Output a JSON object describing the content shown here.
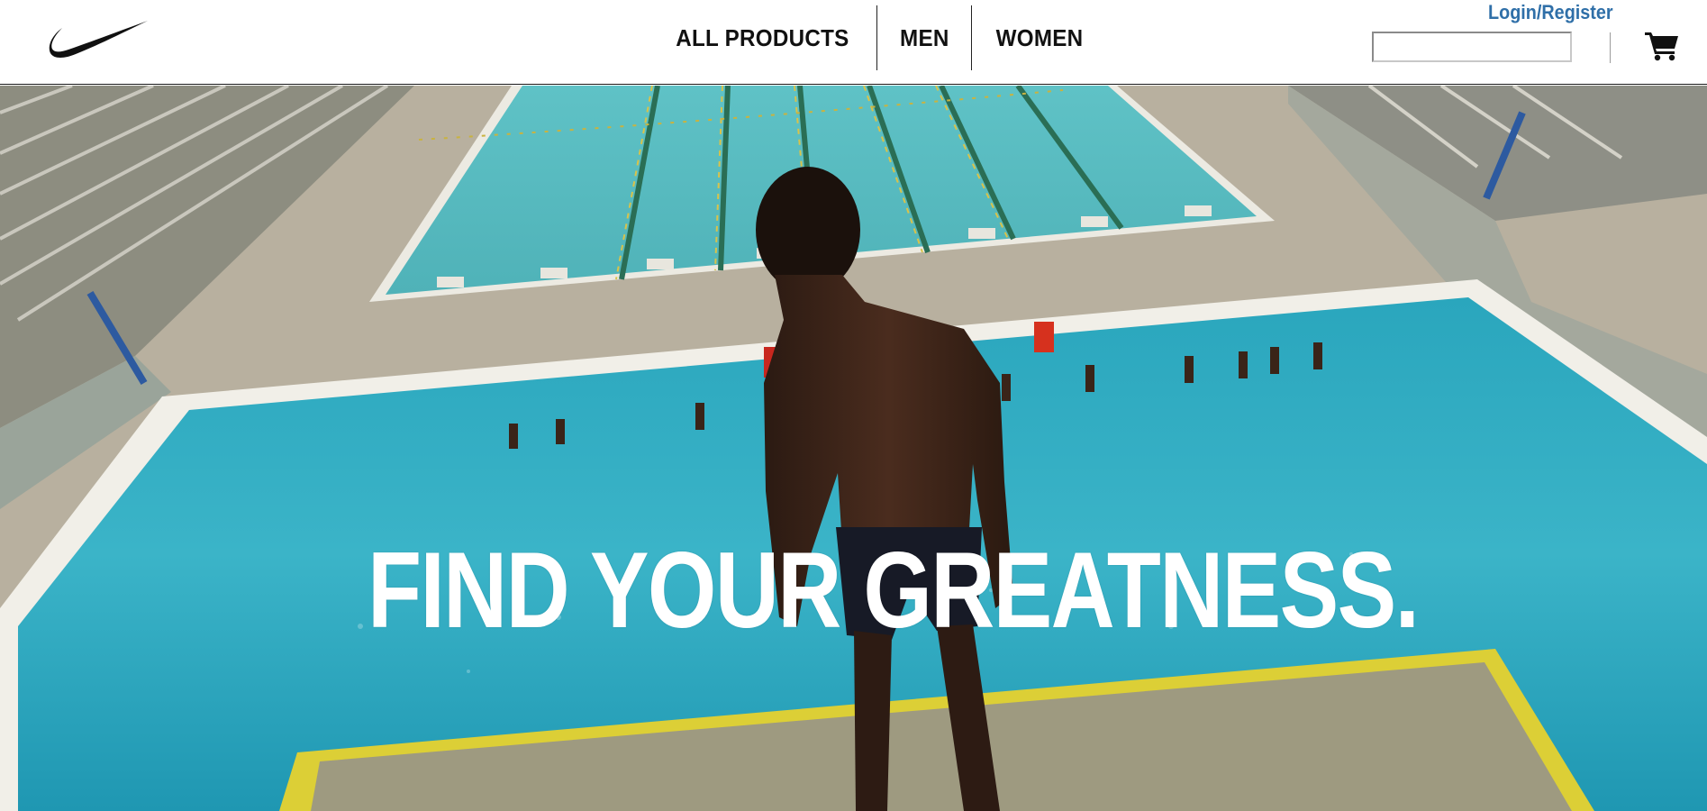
{
  "header": {
    "logo_icon": "swoosh-logo-icon",
    "nav": [
      {
        "label": "ALL PRODUCTS"
      },
      {
        "label": "MEN"
      },
      {
        "label": "WOMEN"
      }
    ],
    "login_label": "Login/Register",
    "search": {
      "value": "",
      "placeholder": ""
    },
    "cart_icon": "shopping-cart-icon"
  },
  "hero": {
    "headline": "FIND YOUR GREATNESS."
  },
  "colors": {
    "link": "#2f6fa8",
    "nav_text": "#111111",
    "pool_water": "#3fb3c8",
    "lap_pool": "#63c4c6",
    "deck": "#b9b1a1",
    "headline": "#ffffff"
  }
}
